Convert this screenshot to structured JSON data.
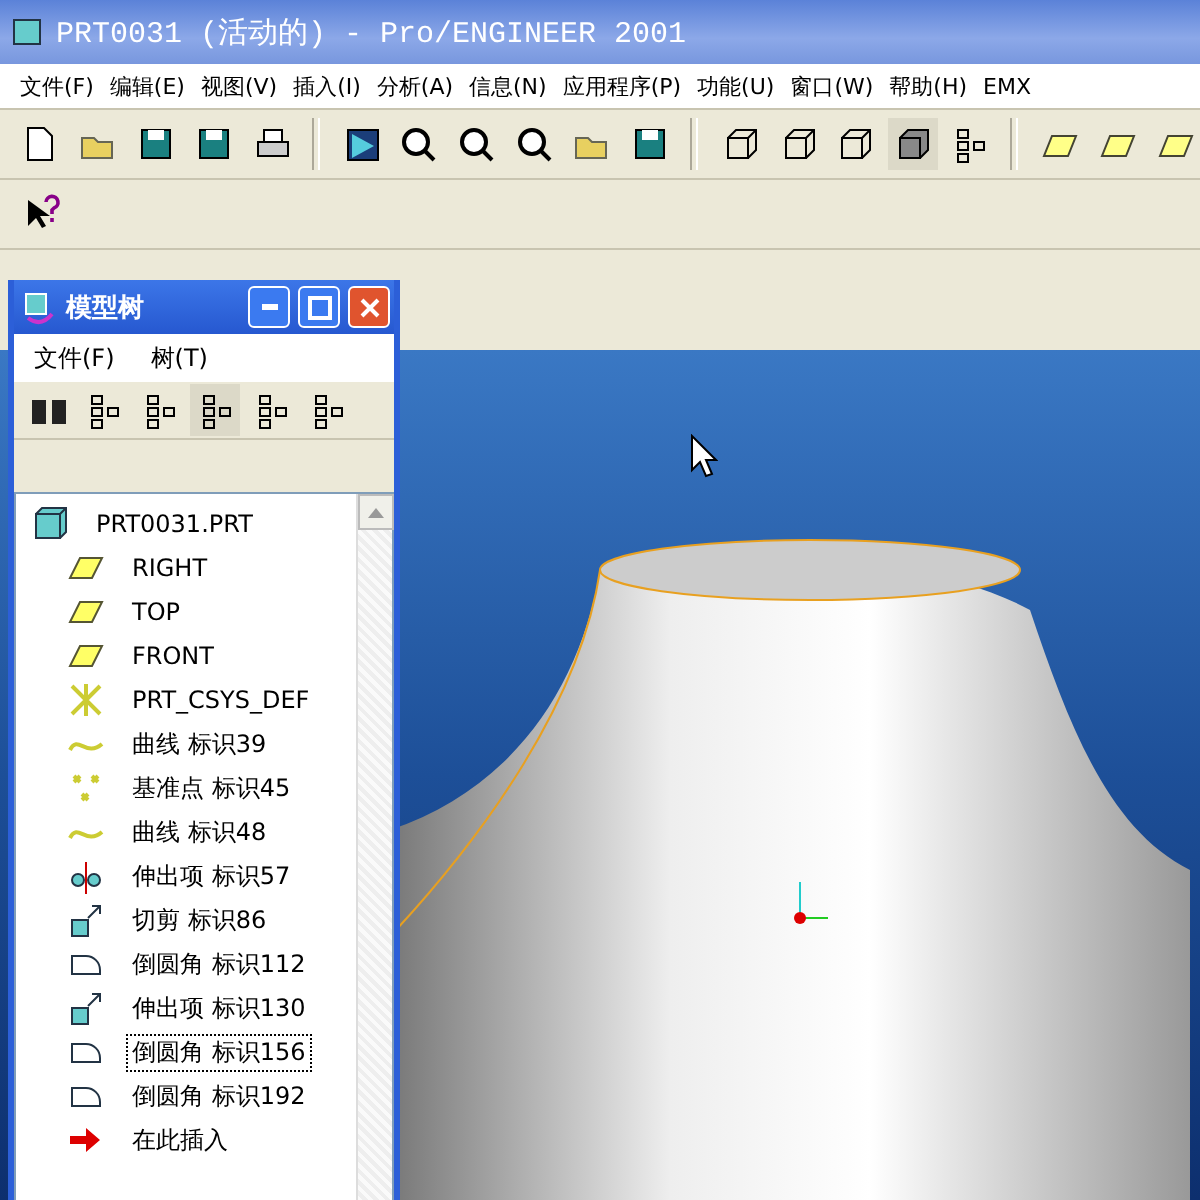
{
  "window": {
    "title": "PRT0031 (活动的) - Pro/ENGINEER 2001"
  },
  "menu": [
    "文件(F)",
    "编辑(E)",
    "视图(V)",
    "插入(I)",
    "分析(A)",
    "信息(N)",
    "应用程序(P)",
    "功能(U)",
    "窗口(W)",
    "帮助(H)",
    "EMX"
  ],
  "model_tree": {
    "title": "模型树",
    "menu": [
      "文件(F)",
      "树(T)"
    ],
    "items": [
      {
        "kind": "part",
        "label": "PRT0031.PRT",
        "selected": false
      },
      {
        "kind": "plane",
        "label": "RIGHT",
        "selected": false
      },
      {
        "kind": "plane",
        "label": "TOP",
        "selected": false
      },
      {
        "kind": "plane",
        "label": "FRONT",
        "selected": false
      },
      {
        "kind": "csys",
        "label": "PRT_CSYS_DEF",
        "selected": false
      },
      {
        "kind": "curve",
        "label": "曲线 标识39",
        "selected": false
      },
      {
        "kind": "point",
        "label": "基准点 标识45",
        "selected": false
      },
      {
        "kind": "curve",
        "label": "曲线 标识48",
        "selected": false
      },
      {
        "kind": "protrusion",
        "label": "伸出项 标识57",
        "selected": false
      },
      {
        "kind": "cut",
        "label": "切剪 标识86",
        "selected": false
      },
      {
        "kind": "round",
        "label": "倒圆角 标识112",
        "selected": false
      },
      {
        "kind": "cut",
        "label": "伸出项 标识130",
        "selected": false
      },
      {
        "kind": "round",
        "label": "倒圆角 标识156",
        "selected": true
      },
      {
        "kind": "round",
        "label": "倒圆角 标识192",
        "selected": false
      },
      {
        "kind": "insert",
        "label": "在此插入",
        "selected": false
      }
    ]
  }
}
